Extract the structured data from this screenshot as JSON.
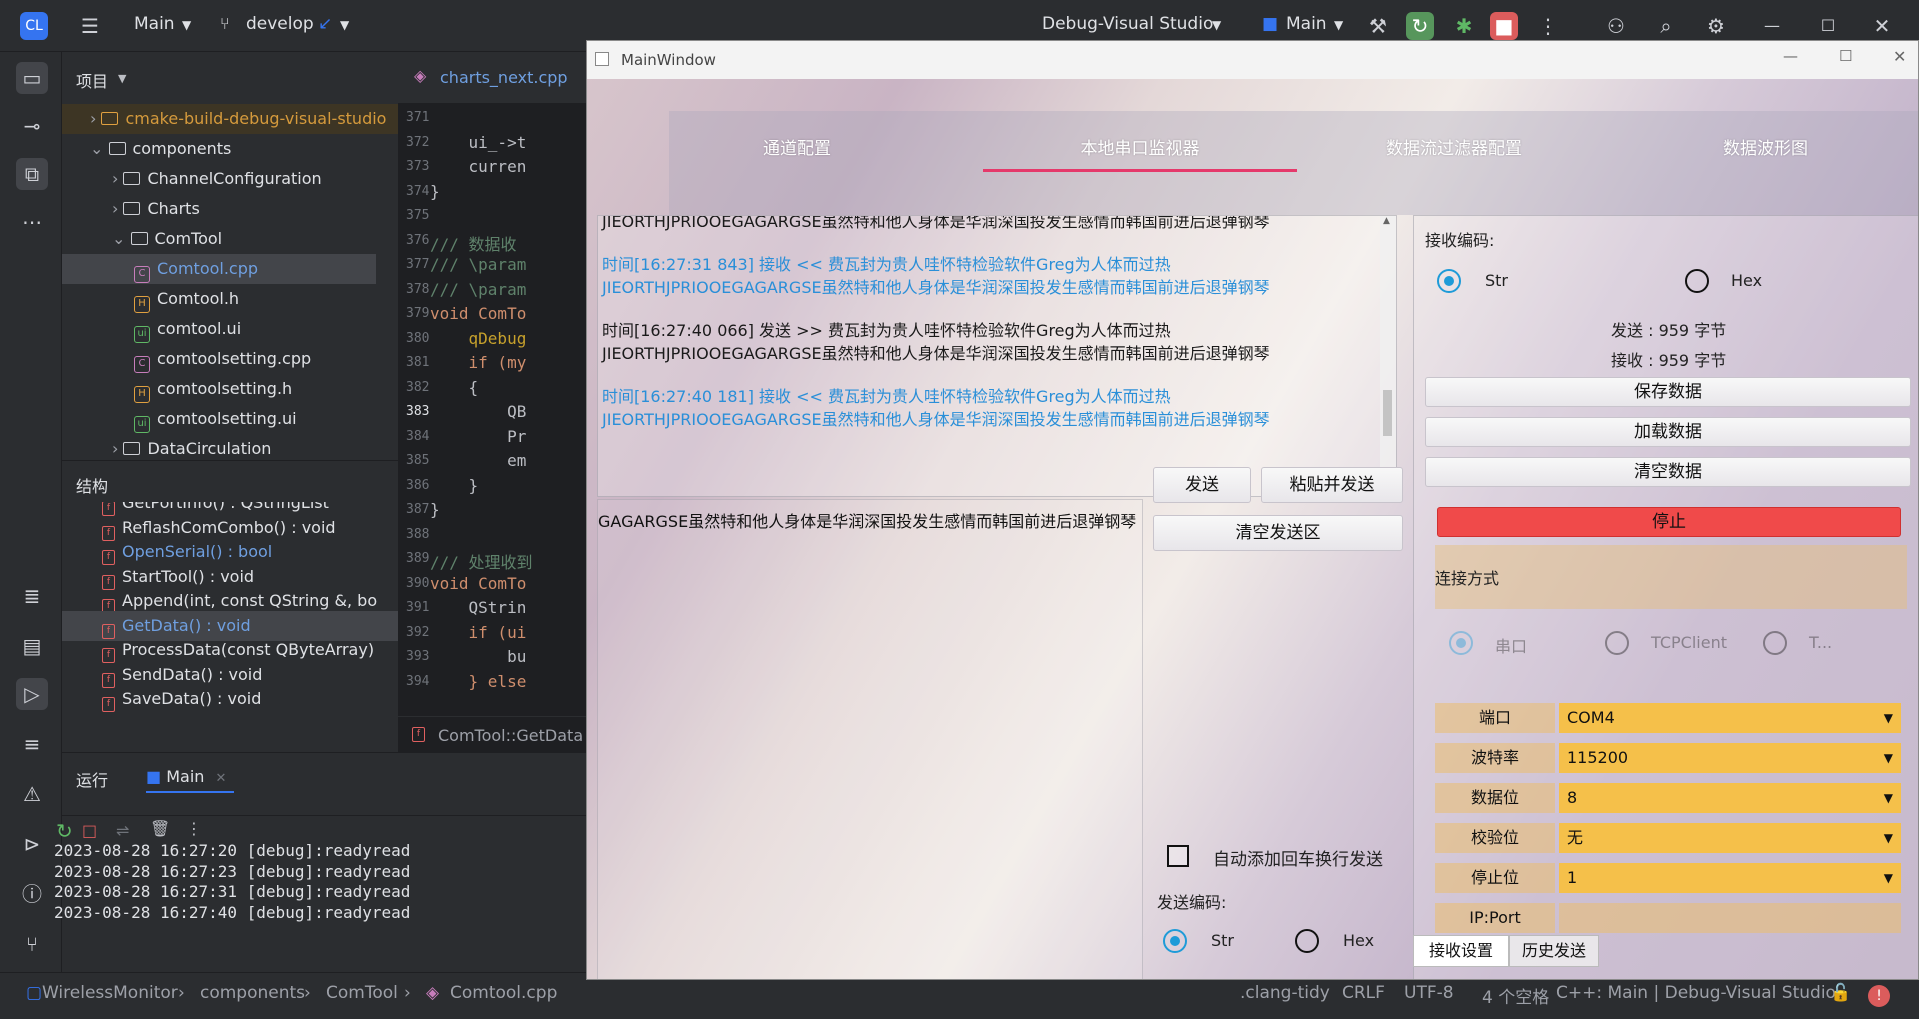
{
  "ide": {
    "project_menu": "Main",
    "branch": "develop",
    "run_config": "Debug-Visual Studio",
    "run_target": "Main",
    "project_panel_title": "项目",
    "structure_title": "结构",
    "run_title": "运行",
    "run_tab": "Main",
    "editor_tab": "charts_next.cpp",
    "breadcrumb_fn": "ComTool::GetData"
  },
  "tree": [
    {
      "label": "cmake-build-debug-visual-studio",
      "kind": "folder",
      "indent": 0,
      "expanded": false
    },
    {
      "label": "components",
      "kind": "folder",
      "indent": 0,
      "expanded": true
    },
    {
      "label": "ChannelConfiguration",
      "kind": "folder",
      "indent": 1,
      "expanded": false
    },
    {
      "label": "Charts",
      "kind": "folder",
      "indent": 1,
      "expanded": false
    },
    {
      "label": "ComTool",
      "kind": "folder",
      "indent": 1,
      "expanded": true
    },
    {
      "label": "Comtool.cpp",
      "kind": "cpp",
      "indent": 2,
      "selected": true
    },
    {
      "label": "Comtool.h",
      "kind": "h",
      "indent": 2
    },
    {
      "label": "comtool.ui",
      "kind": "ui",
      "indent": 2
    },
    {
      "label": "comtoolsetting.cpp",
      "kind": "cpp",
      "indent": 2
    },
    {
      "label": "comtoolsetting.h",
      "kind": "h",
      "indent": 2
    },
    {
      "label": "comtoolsetting.ui",
      "kind": "ui",
      "indent": 2
    },
    {
      "label": "DataCirculation",
      "kind": "folder",
      "indent": 1
    }
  ],
  "structure": [
    "GetPortInfo() : QStringList",
    "ReflashComCombo() : void",
    "OpenSerial() : bool",
    "StartTool() : void",
    "Append(int, const QString &, bo",
    "GetData() : void",
    "ProcessData(const QByteArray)",
    "SendData() : void",
    "SaveData() : void"
  ],
  "code_lines": [
    {
      "n": "371",
      "t": ""
    },
    {
      "n": "372",
      "t": "    ui_->t"
    },
    {
      "n": "373",
      "t": "    curren"
    },
    {
      "n": "374",
      "t": "}"
    },
    {
      "n": "375",
      "t": ""
    },
    {
      "n": "376",
      "t": "/// 数据收"
    },
    {
      "n": "377",
      "t": "/// \\param"
    },
    {
      "n": "378",
      "t": "/// \\param"
    },
    {
      "n": "379",
      "t": "void ComTo"
    },
    {
      "n": "380",
      "t": "    qDebug"
    },
    {
      "n": "381",
      "t": "    if (my"
    },
    {
      "n": "382",
      "t": "    {"
    },
    {
      "n": "383",
      "t": "        QB"
    },
    {
      "n": "384",
      "t": "        Pr"
    },
    {
      "n": "385",
      "t": "        em"
    },
    {
      "n": "386",
      "t": "    }"
    },
    {
      "n": "387",
      "t": "}"
    },
    {
      "n": "388",
      "t": ""
    },
    {
      "n": "389",
      "t": "/// 处理收到"
    },
    {
      "n": "390",
      "t": "void ComTo"
    },
    {
      "n": "391",
      "t": "    QStrin"
    },
    {
      "n": "392",
      "t": "    if (ui"
    },
    {
      "n": "393",
      "t": "        bu"
    },
    {
      "n": "394",
      "t": "    } else"
    }
  ],
  "run_log": [
    "2023-08-28 16:27:20 [debug]:readyread",
    "2023-08-28 16:27:23 [debug]:readyread",
    "2023-08-28 16:27:31 [debug]:readyread",
    "2023-08-28 16:27:40 [debug]:readyread"
  ],
  "status": {
    "crumbs": [
      "WirelessMonitor",
      "components",
      "ComTool",
      "Comtool.cpp"
    ],
    "clang": ".clang-tidy",
    "eol": "CRLF",
    "enc": "UTF-8",
    "indent": "4 个空格",
    "ctx": "C++: Main | Debug-Visual Studio"
  },
  "app": {
    "title": "MainWindow",
    "tabs": [
      "通道配置",
      "本地串口监视器",
      "数据流过滤器配置",
      "数据波形图"
    ],
    "active_tab": 1,
    "messages": [
      {
        "lines": [
          "JIEORTHJPRIOOEGAGARGSE虽然特和他人身体是华润深国投发生感情而韩国前进后退弹钢琴"
        ],
        "color": "#1a1a1a"
      },
      {
        "lines": [
          "时间[16:27:31 843] 接收 << 费瓦封为贵人哇怀特检验软件Greg为人体而过热",
          "JIEORTHJPRIOOEGAGARGSE虽然特和他人身体是华润深国投发生感情而韩国前进后退弹钢琴"
        ],
        "color": "#2a8fd8"
      },
      {
        "lines": [
          "时间[16:27:40 066] 发送 >> 费瓦封为贵人哇怀特检验软件Greg为人体而过热",
          "JIEORTHJPRIOOEGAGARGSE虽然特和他人身体是华润深国投发生感情而韩国前进后退弹钢琴"
        ],
        "color": "#1a1a1a"
      },
      {
        "lines": [
          "时间[16:27:40 181] 接收 << 费瓦封为贵人哇怀特检验软件Greg为人体而过热",
          "JIEORTHJPRIOOEGAGARGSE虽然特和他人身体是华润深国投发生感情而韩国前进后退弹钢琴"
        ],
        "color": "#2a8fd8"
      }
    ],
    "send_text": "GAGARGSE虽然特和他人身体是华润深国投发生感情而韩国前进后退弹钢琴",
    "send_btn": "发送",
    "paste_send_btn": "粘贴并发送",
    "clear_send_btn": "清空发送区",
    "auto_newline": "自动添加回车换行发送",
    "send_encoding": "发送编码:",
    "recv_encoding": "接收编码:",
    "str": "Str",
    "hex": "Hex",
    "sent_count": "发送 : 959 字节",
    "recv_count": "接收 : 959 字节",
    "save_btn": "保存数据",
    "load_btn": "加载数据",
    "clear_btn": "清空数据",
    "stop_btn": "停止",
    "conn_label": "连接方式",
    "conn_opts": [
      "串口",
      "TCPClient",
      "T..."
    ],
    "settings": [
      {
        "label": "端口",
        "value": "COM4"
      },
      {
        "label": "波特率",
        "value": "115200"
      },
      {
        "label": "数据位",
        "value": "8"
      },
      {
        "label": "校验位",
        "value": "无"
      },
      {
        "label": "停止位",
        "value": "1"
      },
      {
        "label": "IP:Port",
        "value": ""
      }
    ],
    "bottom_tabs": [
      "接收设置",
      "历史发送"
    ],
    "accent": "#e5396b",
    "stop_color": "#f04a4a",
    "combo_color": "#f5c04a"
  }
}
